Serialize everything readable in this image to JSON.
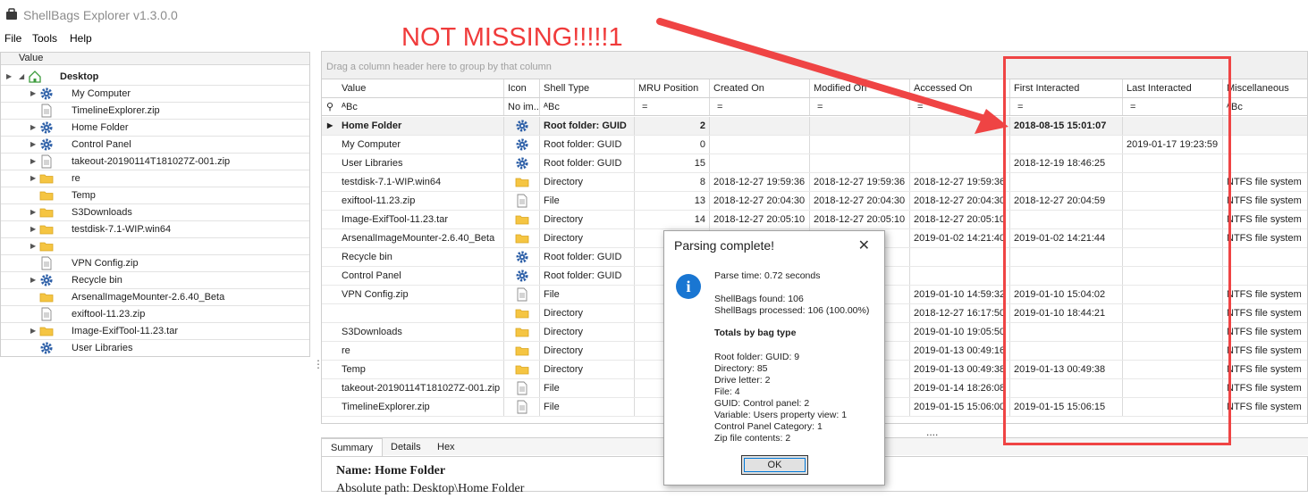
{
  "window": {
    "title": "ShellBags Explorer v1.3.0.0"
  },
  "menu": {
    "items": [
      "File",
      "Tools",
      "Help"
    ]
  },
  "tree": {
    "header": "Value",
    "root": "Desktop",
    "items": [
      {
        "label": "My Computer",
        "icon": "gear-icon",
        "expandable": true
      },
      {
        "label": "TimelineExplorer.zip",
        "icon": "file-icon",
        "expandable": false
      },
      {
        "label": "Home Folder",
        "icon": "gear-icon",
        "expandable": true
      },
      {
        "label": "Control Panel",
        "icon": "gear-icon",
        "expandable": true
      },
      {
        "label": "takeout-20190114T181027Z-001.zip",
        "icon": "file-icon",
        "expandable": true
      },
      {
        "label": "re",
        "icon": "folder-icon",
        "expandable": true
      },
      {
        "label": "Temp",
        "icon": "folder-icon",
        "expandable": false
      },
      {
        "label": "S3Downloads",
        "icon": "folder-icon",
        "expandable": true
      },
      {
        "label": "testdisk-7.1-WIP.win64",
        "icon": "folder-icon",
        "expandable": true
      },
      {
        "label": "",
        "icon": "folder-icon",
        "expandable": true
      },
      {
        "label": "VPN Config.zip",
        "icon": "file-icon",
        "expandable": false
      },
      {
        "label": "Recycle bin",
        "icon": "gear-icon",
        "expandable": true
      },
      {
        "label": "ArsenalImageMounter-2.6.40_Beta",
        "icon": "folder-icon",
        "expandable": false
      },
      {
        "label": "exiftool-11.23.zip",
        "icon": "file-icon",
        "expandable": false
      },
      {
        "label": "Image-ExifTool-11.23.tar",
        "icon": "folder-icon",
        "expandable": true
      },
      {
        "label": "User Libraries",
        "icon": "gear-icon",
        "expandable": false
      }
    ]
  },
  "grid": {
    "group_hint": "Drag a column header here to group by that column",
    "columns": [
      "Value",
      "Icon",
      "Shell Type",
      "MRU Position",
      "Created On",
      "Modified On",
      "Accessed On",
      "First Interacted",
      "Last Interacted",
      "Miscellaneous"
    ],
    "filter": {
      "value": "ᴬB͏c",
      "icon": "No im...",
      "shell_type": "ᴬB͏c",
      "misc": "ᴬB͏c",
      "eq": "="
    },
    "rows": [
      {
        "value": "Home Folder",
        "icon": "gear-icon",
        "shell": "Root folder: GUID",
        "mru": "2",
        "created": "",
        "modified": "",
        "accessed": "",
        "first": "2018-08-15 15:01:07",
        "last": "",
        "misc": ""
      },
      {
        "value": "My Computer",
        "icon": "gear-icon",
        "shell": "Root folder: GUID",
        "mru": "0",
        "created": "",
        "modified": "",
        "accessed": "",
        "first": "",
        "last": "2019-01-17 19:23:59",
        "misc": ""
      },
      {
        "value": "User Libraries",
        "icon": "gear-icon",
        "shell": "Root folder: GUID",
        "mru": "15",
        "created": "",
        "modified": "",
        "accessed": "",
        "first": "2018-12-19 18:46:25",
        "last": "",
        "misc": ""
      },
      {
        "value": "testdisk-7.1-WIP.win64",
        "icon": "folder-icon",
        "shell": "Directory",
        "mru": "8",
        "created": "2018-12-27 19:59:36",
        "modified": "2018-12-27 19:59:36",
        "accessed": "2018-12-27 19:59:36",
        "first": "",
        "last": "",
        "misc": "NTFS file system"
      },
      {
        "value": "exiftool-11.23.zip",
        "icon": "file-icon",
        "shell": "File",
        "mru": "13",
        "created": "2018-12-27 20:04:30",
        "modified": "2018-12-27 20:04:30",
        "accessed": "2018-12-27 20:04:30",
        "first": "2018-12-27 20:04:59",
        "last": "",
        "misc": "NTFS file system"
      },
      {
        "value": "Image-ExifTool-11.23.tar",
        "icon": "folder-icon",
        "shell": "Directory",
        "mru": "14",
        "created": "2018-12-27 20:05:10",
        "modified": "2018-12-27 20:05:10",
        "accessed": "2018-12-27 20:05:10",
        "first": "",
        "last": "",
        "misc": "NTFS file system"
      },
      {
        "value": "ArsenalImageMounter-2.6.40_Beta",
        "icon": "folder-icon",
        "shell": "Directory",
        "mru": "",
        "created": "",
        "modified": "1:40",
        "accessed": "2019-01-02 14:21:40",
        "first": "2019-01-02 14:21:44",
        "last": "",
        "misc": "NTFS file system"
      },
      {
        "value": "Recycle bin",
        "icon": "gear-icon",
        "shell": "Root folder: GUID",
        "mru": "",
        "created": "",
        "modified": "",
        "accessed": "",
        "first": "",
        "last": "",
        "misc": ""
      },
      {
        "value": "Control Panel",
        "icon": "gear-icon",
        "shell": "Root folder: GUID",
        "mru": "",
        "created": "",
        "modified": "",
        "accessed": "",
        "first": "",
        "last": "",
        "misc": ""
      },
      {
        "value": "VPN Config.zip",
        "icon": "file-icon",
        "shell": "File",
        "mru": "",
        "created": "",
        "modified": "9:28",
        "accessed": "2019-01-10 14:59:32",
        "first": "2019-01-10 15:04:02",
        "last": "",
        "misc": "NTFS file system"
      },
      {
        "value": "",
        "icon": "folder-icon",
        "shell": "Directory",
        "mru": "",
        "created": "",
        "modified": "7:50",
        "accessed": "2018-12-27 16:17:50",
        "first": "2019-01-10 18:44:21",
        "last": "",
        "misc": "NTFS file system"
      },
      {
        "value": "S3Downloads",
        "icon": "folder-icon",
        "shell": "Directory",
        "mru": "",
        "created": "",
        "modified": "5:50",
        "accessed": "2019-01-10 19:05:50",
        "first": "",
        "last": "",
        "misc": "NTFS file system"
      },
      {
        "value": "re",
        "icon": "folder-icon",
        "shell": "Directory",
        "mru": "",
        "created": "",
        "modified": "9:16",
        "accessed": "2019-01-13 00:49:16",
        "first": "",
        "last": "",
        "misc": "NTFS file system"
      },
      {
        "value": "Temp",
        "icon": "folder-icon",
        "shell": "Directory",
        "mru": "",
        "created": "",
        "modified": "9:38",
        "accessed": "2019-01-13 00:49:38",
        "first": "2019-01-13 00:49:38",
        "last": "",
        "misc": "NTFS file system"
      },
      {
        "value": "takeout-20190114T181027Z-001.zip",
        "icon": "file-icon",
        "shell": "File",
        "mru": "",
        "created": "",
        "modified": "6:08",
        "accessed": "2019-01-14 18:26:08",
        "first": "",
        "last": "",
        "misc": "NTFS file system"
      },
      {
        "value": "TimelineExplorer.zip",
        "icon": "file-icon",
        "shell": "File",
        "mru": "",
        "created": "",
        "modified": "0:08",
        "accessed": "2019-01-15 15:06:00",
        "first": "2019-01-15 15:06:15",
        "last": "",
        "misc": "NTFS file system"
      }
    ]
  },
  "status_dots": "....",
  "tabs": [
    "Summary",
    "Details",
    "Hex"
  ],
  "summary": {
    "name_label": "Name:",
    "name_value": "Home Folder",
    "path_line": "Absolute path: Desktop\\Home Folder"
  },
  "dialog": {
    "title": "Parsing complete!",
    "lines": [
      "Parse time: 0.72 seconds",
      "ShellBags found: 106",
      "ShellBags processed: 106 (100.00%)",
      "Totals by bag type",
      "Root folder: GUID: 9",
      "Directory: 85",
      "Drive letter: 2",
      "File: 4",
      "GUID: Control panel: 2",
      "Variable: Users property view: 1",
      "Control Panel Category: 1",
      "Zip file contents: 2"
    ],
    "ok": "OK"
  },
  "annotation": {
    "text": "NOT MISSING!!!!!1",
    "color": "#f03b3b"
  },
  "colors": {
    "gear": "#2b5ea7",
    "folder": "#f5c542",
    "accent": "#0078d7"
  }
}
